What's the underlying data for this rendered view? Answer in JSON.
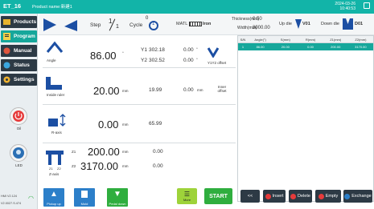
{
  "header": {
    "title": "ET_16",
    "product_name": "Product name:新建1",
    "date": "2024-03-26",
    "time": "10:40:53"
  },
  "sidebar": {
    "items": [
      {
        "label": "Products",
        "active": false
      },
      {
        "label": "Program",
        "active": true
      },
      {
        "label": "Manual",
        "active": false
      },
      {
        "label": "Status",
        "active": false
      },
      {
        "label": "Settings",
        "active": false
      }
    ],
    "oil_label": "Oil",
    "led_label": "LED",
    "hmi_version": "HMI V2.124",
    "hmi_version2": "V2.0027.S.474"
  },
  "toolbar": {
    "step_label": "Step",
    "step_value": "1",
    "step_total": "1",
    "cycle_label": "Cycle",
    "cycle_value": "0",
    "cycle_total": "1",
    "matl_label": "MATL",
    "matl_value": "Iron",
    "thickness_label": "Thickness(mm)",
    "thickness_value": "0.50",
    "width_label": "Width(mm)",
    "width_value": "3000.00",
    "updie_label": "Up die",
    "updie_value": "V01",
    "downdie_label": "Down die",
    "downdie_value": "D01"
  },
  "params": {
    "angle_label": "Angle",
    "angle_value": "86.00",
    "angle_unit": "°",
    "y1_label": "Y1",
    "y1_value": "302.18",
    "y2_label": "Y2",
    "y2_value": "302.52",
    "y1_offset": "0.00",
    "y2_offset": "0.00",
    "deg_sym": "°",
    "y1y2_label": "Y1Y2 offset",
    "inside_label": "Inside ruler",
    "inside_value": "20.00",
    "inside_unit": "mm",
    "inside_actual": "19.99",
    "inner_offset_value": "0.00",
    "inner_offset_unit": "mm",
    "inner_offset_label": "Inner offset",
    "raxis_label": "R-axis",
    "raxis_value": "0.00",
    "raxis_unit": "mm",
    "raxis_actual": "65.99",
    "zaxis_label": "Z-axis",
    "z1_label": "Z1",
    "z1_value": "200.00",
    "z1_unit": "mm",
    "z1_actual": "0.00",
    "z2_label": "Z2",
    "z2_value": "3170.00",
    "z2_unit": "mm",
    "z2_actual": "0.00"
  },
  "table": {
    "headers": [
      "S/N",
      "Angle(°)",
      "S(mm)",
      "R(mm)",
      "Z1(mm)",
      "Z2(mm)"
    ],
    "rows": [
      [
        "1",
        "86.00",
        "20.00",
        "0.00",
        "200.00",
        "3170.00"
      ]
    ]
  },
  "bottom": {
    "pickup_label": "Pickup up",
    "mold_label": "Mold",
    "pedal_label": "Pedal down",
    "more_label": "More",
    "start_label": "START",
    "prev_label": "<<",
    "insert_label": "Insert",
    "delete_label": "Delete",
    "empty_label": "Empty",
    "exchange_label": "Exchange"
  },
  "colors": {
    "accent": "#16a79b",
    "dark": "#2d3a45",
    "blue": "#2c7fc9",
    "green": "#2fae3e",
    "red": "#e63b3b"
  }
}
